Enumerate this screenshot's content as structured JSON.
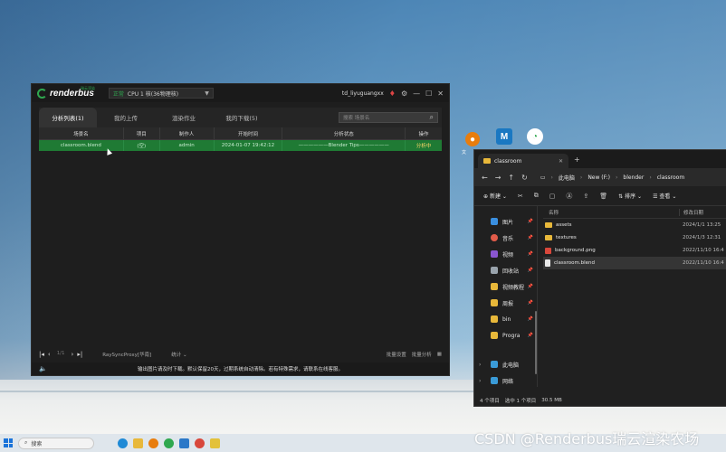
{
  "renderbus": {
    "logo_small": "瑞云渲染",
    "logo_text": "renderbus",
    "mode_prefix": "正常",
    "mode_value": "CPU 1 核(36物理核)",
    "username": "td_liyuguangxx",
    "tabs": [
      {
        "label": "分析列表(1)"
      },
      {
        "label": "我的上传"
      },
      {
        "label": "渲染作业"
      },
      {
        "label": "我的下载(5)"
      }
    ],
    "search_placeholder": "搜索 场景名",
    "columns": [
      "场景名",
      "项目",
      "制作人",
      "开始时间",
      "分析状态",
      "操作"
    ],
    "row": {
      "scene": "classroom.blend",
      "project": "(空)",
      "maker": "admin",
      "start": "2024-01-07 19:42:12",
      "status": "——————Blender Tips——————",
      "action": "分析中"
    },
    "footer": {
      "page": "1/1",
      "proxy": "RaySyncProxy[华南]",
      "stat": "统计",
      "right1": "批量设置",
      "right2": "批量分析"
    },
    "notice": "输出图片请及时下载。默认保留20天，过期系统自动清除。若有特殊需求，请联系在线客服。"
  },
  "desktop": {
    "icon_label": "文"
  },
  "explorer": {
    "tab_title": "classroom",
    "path": [
      "此电脑",
      "New (F:)",
      "blender",
      "classroom"
    ],
    "new_label": "新建",
    "sort_label": "排序",
    "view_label": "查看",
    "sidebar": [
      {
        "label": "图片",
        "color": "#3a8fe0"
      },
      {
        "label": "音乐",
        "color": "#e25c4a"
      },
      {
        "label": "视频",
        "color": "#8a56d0"
      },
      {
        "label": "回收站",
        "color": "#9aa4ad"
      },
      {
        "label": "视频教程",
        "color": "#e8b83a"
      },
      {
        "label": "周报",
        "color": "#e8b83a"
      },
      {
        "label": "bin",
        "color": "#e8b83a"
      },
      {
        "label": "Progra",
        "color": "#e8b83a"
      }
    ],
    "sidebar_bottom": [
      {
        "label": "此电脑"
      },
      {
        "label": "网络"
      }
    ],
    "col_name": "名称",
    "col_date": "修改日期",
    "files": [
      {
        "name": "assets",
        "date": "2024/1/1 13:25",
        "type": "folder"
      },
      {
        "name": "textures",
        "date": "2024/1/3 12:31",
        "type": "folder"
      },
      {
        "name": "background.png",
        "date": "2022/11/10 16:4",
        "type": "image"
      },
      {
        "name": "classroom.blend",
        "date": "2022/11/10 16:4",
        "type": "doc"
      }
    ],
    "status": [
      "4 个项目",
      "选中 1 个项目",
      "30.5 MB"
    ]
  },
  "taskbar": {
    "search_placeholder": "搜索"
  },
  "watermark": "CSDN @Renderbus瑞云渲染农场"
}
